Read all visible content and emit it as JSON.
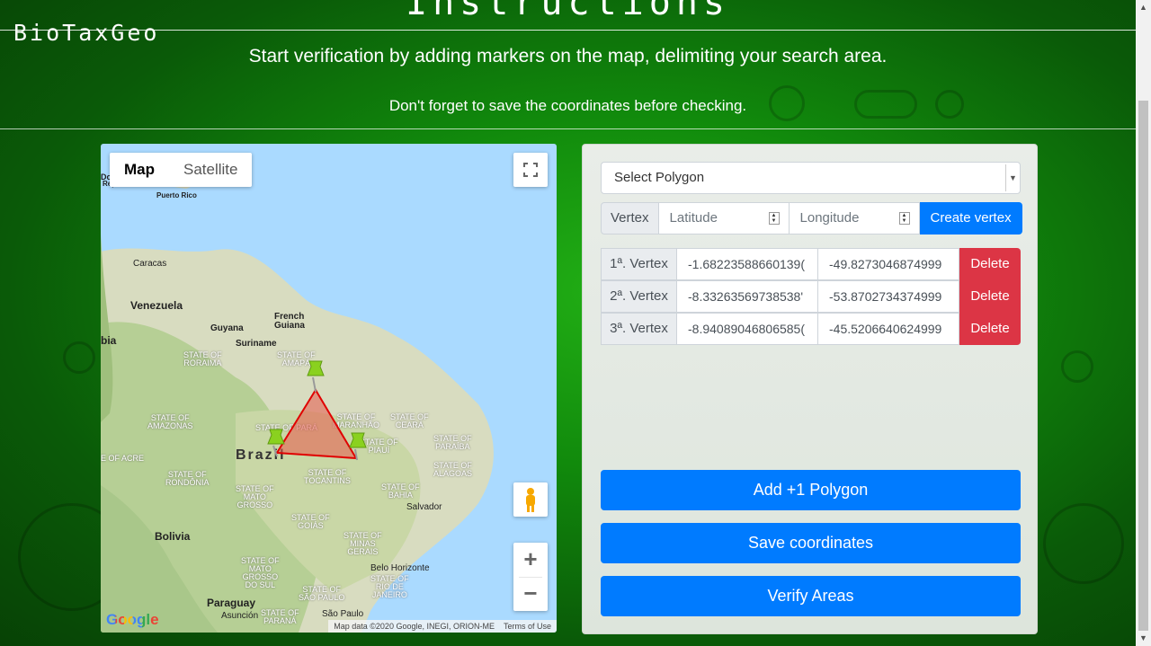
{
  "header": {
    "brand": "BioTaxGeo",
    "title": "Instructions",
    "subtitle": "Start verification by adding markers on the map, delimiting your search area.",
    "note": "Don't forget to save the coordinates before checking."
  },
  "map": {
    "type_buttons": [
      "Map",
      "Satellite"
    ],
    "active_type": "Map",
    "zoom_in": "+",
    "zoom_out": "−",
    "google": "Google",
    "attribution": "Map data ©2020 Google, INEGI, ORION-ME",
    "terms": "Terms of Use",
    "labels": {
      "dominican": "Do",
      "republic": "Republic",
      "puerto_rico": "Puerto Rico",
      "caracas": "Caracas",
      "venezuela": "Venezuela",
      "guyana": "Guyana",
      "french_guiana": "French\nGuiana",
      "suriname": "Suriname",
      "bia": "bia",
      "roraima": "STATE OF\nRORAIMA",
      "amapa": "STATE OF\nAMAPÁ",
      "amazonas": "STATE OF\nAMAZONAS",
      "para": "STATE OF PARÁ",
      "maranhao": "STATE OF\nMARANHÃO",
      "ceara": "STATE OF\nCEARÁ",
      "piaui": "STATE OF\nPIAUÍ",
      "paraiba": "STATE OF\nPARAÍBA",
      "acre": "E OF ACRE",
      "brazil": "Brazil",
      "alagoas": "STATE OF\nALAGOAS",
      "rondonia": "STATE OF\nRONDÔNIA",
      "tocantins": "STATE OF\nTOCANTINS",
      "bahia": "STATE OF\nBAHIA",
      "salvador": "Salvador",
      "mato_grosso": "STATE OF\nMATO\nGROSSO",
      "goias": "STATE OF\nGOIÁS",
      "bolivia": "Bolivia",
      "minas": "STATE OF\nMINAS\nGERAIS",
      "ms": "STATE OF\nMATO\nGROSSO\nDO SUL",
      "belo": "Belo Horizonte",
      "rio": "STATE OF\nRIO DE\nJANEIRO",
      "sao_paulo_state": "STATE OF\nSÃO PAULO",
      "paraguay": "Paraguay",
      "asuncion": "Asunción",
      "parana": "STATE OF\nPARANÁ",
      "sao_paulo": "São Paulo"
    }
  },
  "panel": {
    "select_placeholder": "Select Polygon",
    "vertex_label": "Vertex",
    "latitude_placeholder": "Latitude",
    "longitude_placeholder": "Longitude",
    "create_vertex": "Create vertex",
    "vertices": [
      {
        "label": "1ª. Vertex",
        "lat": "-1.68223588660139(",
        "lng": "-49.8273046874999",
        "delete": "Delete"
      },
      {
        "label": "2ª. Vertex",
        "lat": "-8.33263569738538'",
        "lng": "-53.8702734374999",
        "delete": "Delete"
      },
      {
        "label": "3ª. Vertex",
        "lat": "-8.94089046806585(",
        "lng": "-45.5206640624999",
        "delete": "Delete"
      }
    ],
    "add_polygon": "Add +1 Polygon",
    "save_coordinates": "Save coordinates",
    "verify_areas": "Verify Areas"
  },
  "colors": {
    "primary": "#007bff",
    "danger": "#dc3545",
    "polygon_fill": "#e8574a",
    "polygon_stroke": "#e00000",
    "marker": "#8ad11f"
  }
}
